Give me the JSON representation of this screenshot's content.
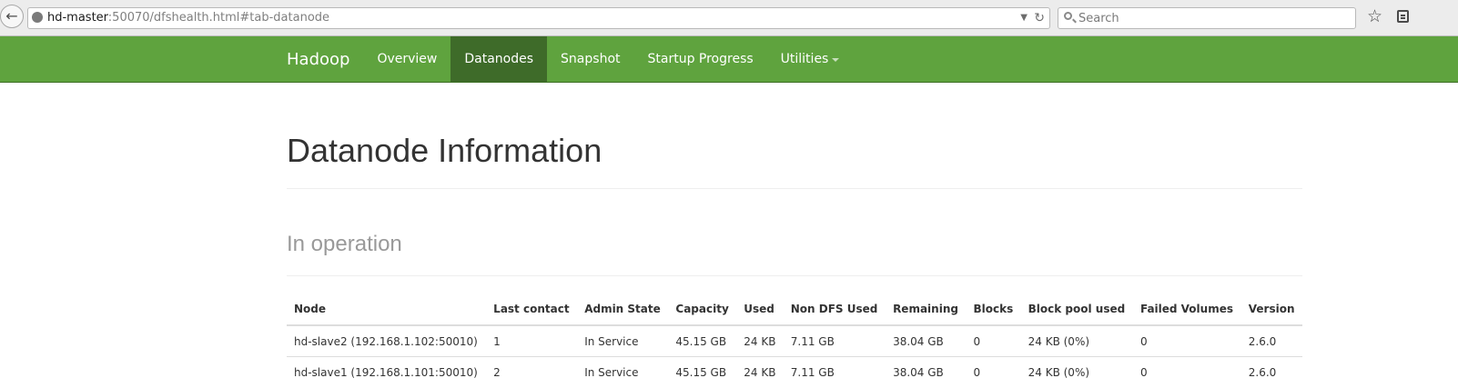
{
  "browser": {
    "url_host": "hd-master",
    "url_path": ":50070/dfshealth.html#tab-datanode",
    "search_placeholder": "Search"
  },
  "navbar": {
    "brand": "Hadoop",
    "items": [
      {
        "label": "Overview",
        "active": false
      },
      {
        "label": "Datanodes",
        "active": true
      },
      {
        "label": "Snapshot",
        "active": false
      },
      {
        "label": "Startup Progress",
        "active": false
      },
      {
        "label": "Utilities",
        "active": false,
        "dropdown": true
      }
    ],
    "color": "#5fa33e",
    "active_color": "#3e6b29"
  },
  "page": {
    "title": "Datanode Information",
    "section": "In operation"
  },
  "table": {
    "headers": [
      "Node",
      "Last contact",
      "Admin State",
      "Capacity",
      "Used",
      "Non DFS Used",
      "Remaining",
      "Blocks",
      "Block pool used",
      "Failed Volumes",
      "Version"
    ],
    "rows": [
      [
        "hd-slave2 (192.168.1.102:50010)",
        "1",
        "In Service",
        "45.15 GB",
        "24 KB",
        "7.11 GB",
        "38.04 GB",
        "0",
        "24 KB (0%)",
        "0",
        "2.6.0"
      ],
      [
        "hd-slave1 (192.168.1.101:50010)",
        "2",
        "In Service",
        "45.15 GB",
        "24 KB",
        "7.11 GB",
        "38.04 GB",
        "0",
        "24 KB (0%)",
        "0",
        "2.6.0"
      ]
    ]
  }
}
